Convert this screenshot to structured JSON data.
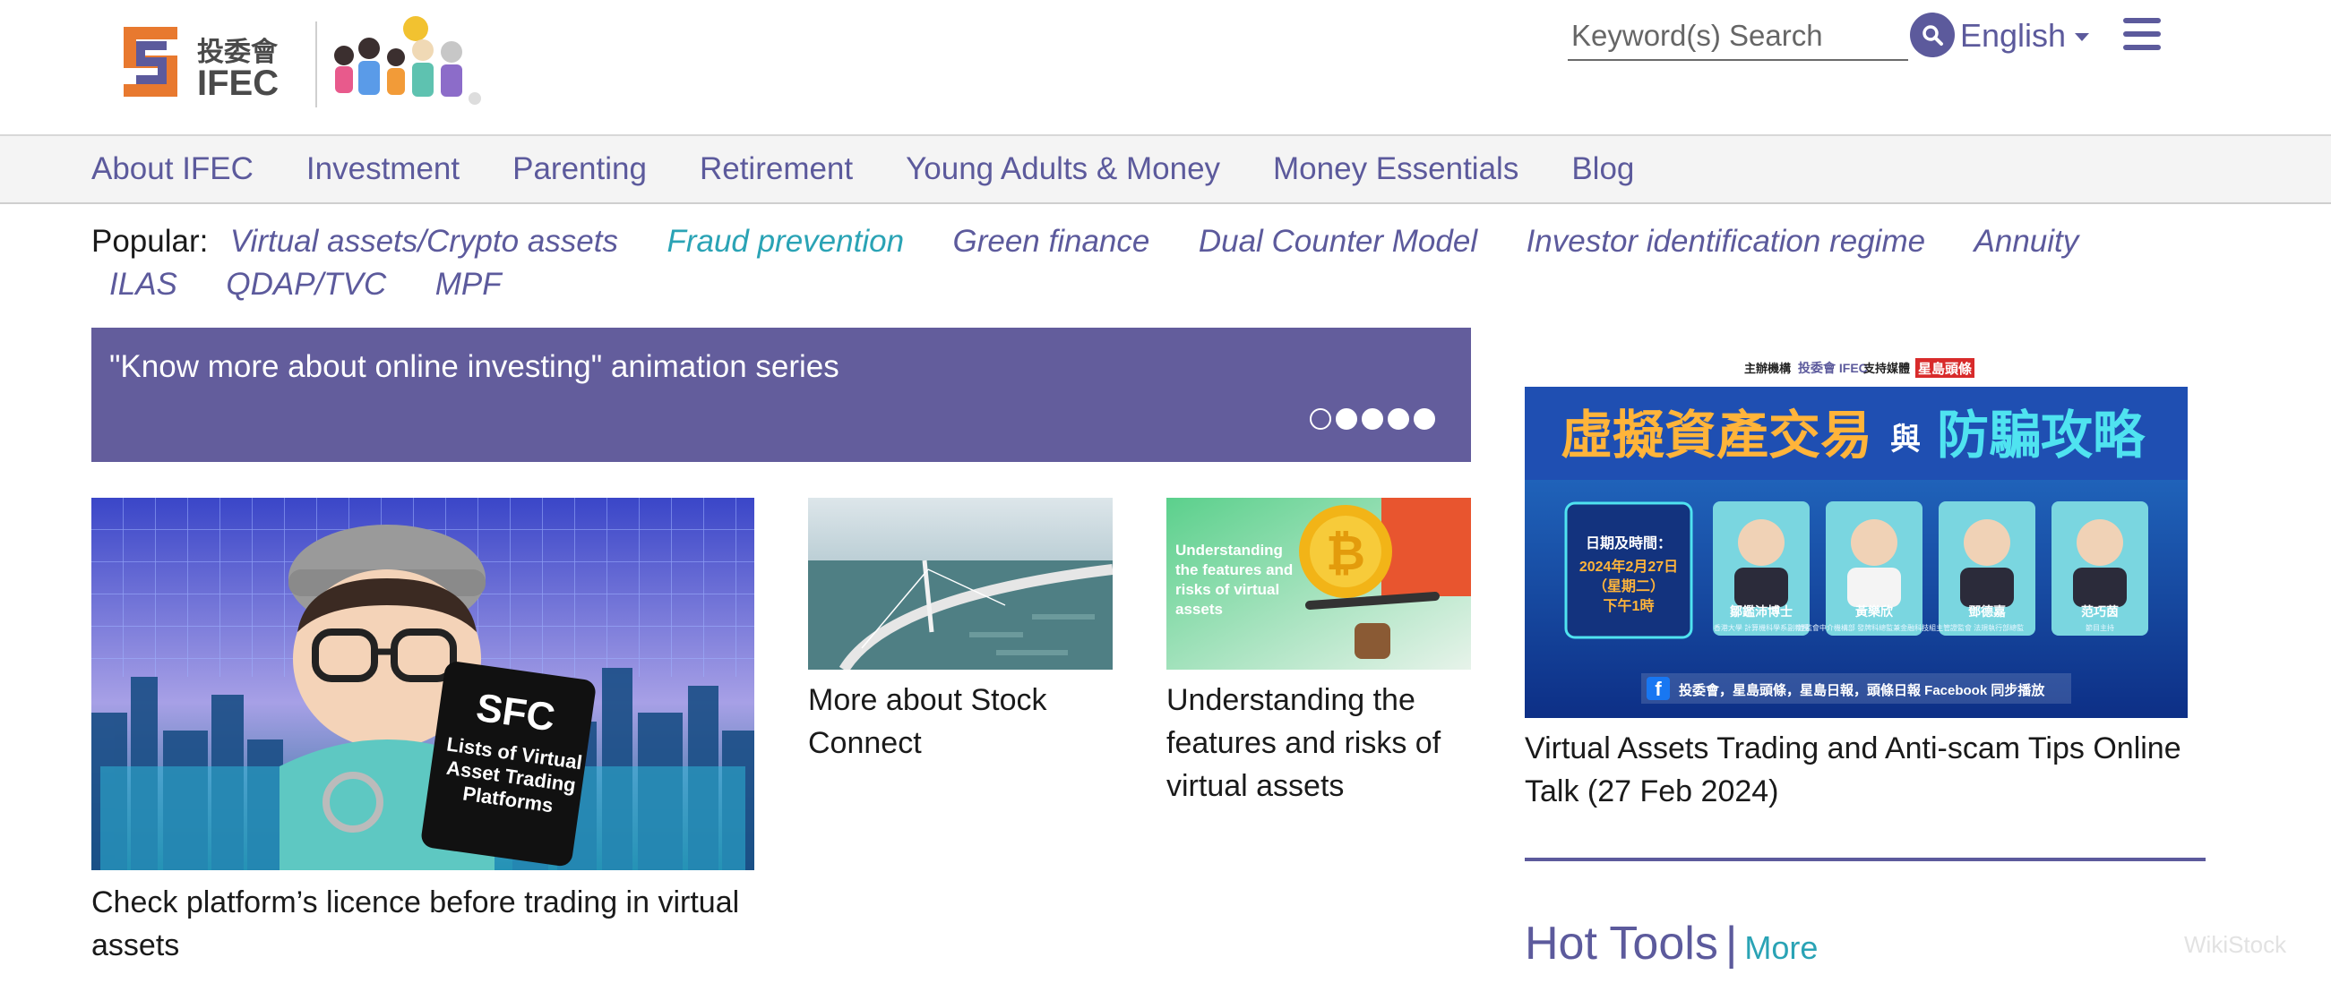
{
  "header": {
    "logo_cn": "投委會",
    "logo_en": "IFEC",
    "search_placeholder": "Keyword(s) Search",
    "language": "English"
  },
  "nav": {
    "items": [
      "About IFEC",
      "Investment",
      "Parenting",
      "Retirement",
      "Young Adults & Money",
      "Money Essentials",
      "Blog"
    ]
  },
  "popular": {
    "label": "Popular:",
    "links": [
      "Virtual assets/Crypto assets",
      "Fraud prevention",
      "Green finance",
      "Dual Counter Model",
      "Investor identification regime",
      "Annuity",
      "ILAS",
      "QDAP/TVC",
      "MPF"
    ]
  },
  "banner": {
    "title": "\"Know more about online investing\" animation series"
  },
  "cards": {
    "sfc": {
      "badge_title": "SFC",
      "badge_text": "Lists of Virtual Asset Trading Platforms",
      "caption": "Check platform’s licence before trading in virtual assets"
    },
    "bridge": {
      "caption": "More about Stock Connect"
    },
    "bitcoin": {
      "overlay": "Understanding the features and risks of virtual assets",
      "caption": "Understanding the features and risks of virtual assets"
    },
    "talk": {
      "top_organizer": "主辦機構",
      "top_ifec": "投委會 IFEC",
      "top_support": "支持媒體",
      "top_media": "星島頭條",
      "headline_a": "虛擬資產交易",
      "headline_b": "與",
      "headline_c": "防騙攻略",
      "date_label": "日期及時間：",
      "date_value": "2024年2月27日",
      "date_weekday": "（星期二）",
      "date_time": "下午1時",
      "speakers": [
        {
          "name": "鄒鑑沛博士",
          "title": "香港大學 計算機科學系副教授"
        },
        {
          "name": "黃樂欣",
          "title": "證監會中介機構部 發牌科總監兼金融科技組主管"
        },
        {
          "name": "鄧德嘉",
          "title": "證監會 法規執行部總監"
        },
        {
          "name": "范巧茵",
          "title": "節目主持"
        }
      ],
      "footer_text": "投委會，星島頭條，星島日報，頭條日報 Facebook 同步播放",
      "caption": "Virtual Assets Trading and Anti-scam Tips Online Talk (27 Feb 2024)"
    }
  },
  "hot_tools": {
    "title": "Hot Tools",
    "separator": "|",
    "more": "More"
  },
  "watermark": "WikiStock",
  "colors": {
    "brand_purple": "#5c5a9c",
    "banner_purple": "#635d9c",
    "teal_link": "#2aa3b5",
    "logo_orange": "#e8792f"
  },
  "carousel": {
    "count": 5,
    "active": 1
  }
}
